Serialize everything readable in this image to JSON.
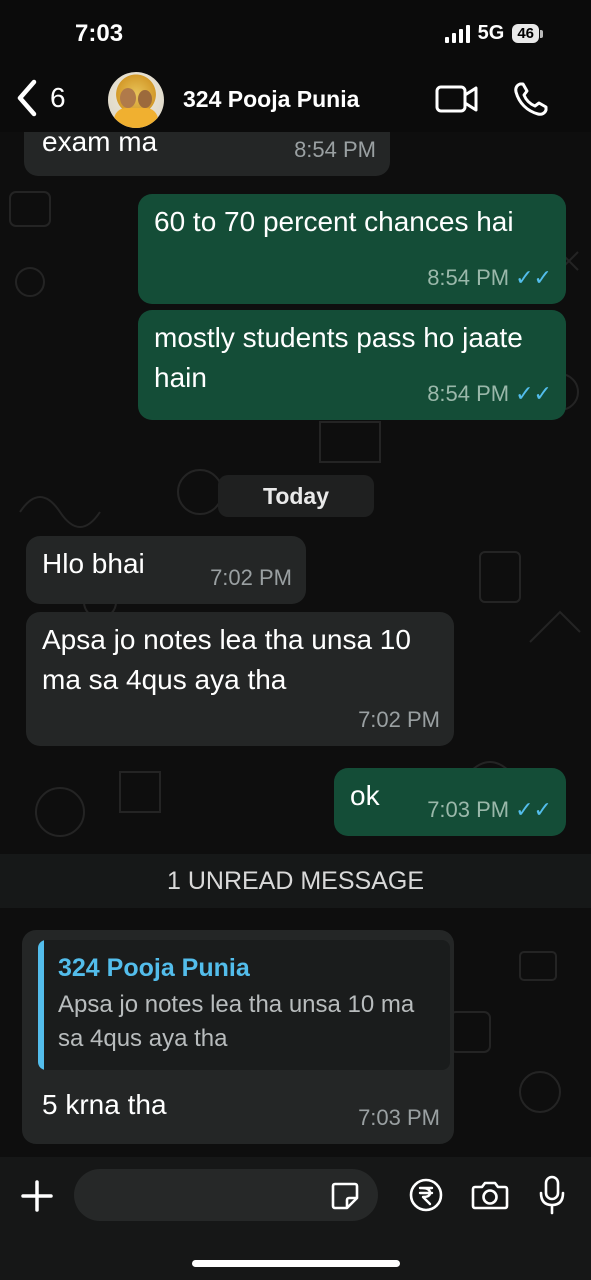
{
  "status": {
    "time": "7:03",
    "network": "5G",
    "battery": "46"
  },
  "header": {
    "back_count": "6",
    "contact_name": "324 Pooja Punia"
  },
  "messages": [
    {
      "direction": "in",
      "text": "exam ma",
      "time": "8:54 PM"
    },
    {
      "direction": "out",
      "text": "60 to 70 percent chances hai",
      "time": "8:54 PM"
    },
    {
      "direction": "out",
      "text": "mostly students pass ho jaate hain",
      "time": "8:54 PM"
    },
    {
      "direction": "in",
      "text": "Hlo bhai",
      "time": "7:02 PM"
    },
    {
      "direction": "in",
      "text": "Apsa jo notes lea tha unsa 10 ma sa 4qus aya tha",
      "time": "7:02 PM"
    },
    {
      "direction": "out",
      "text": "ok",
      "time": "7:03 PM"
    },
    {
      "direction": "in",
      "text": "5 krna tha",
      "time": "7:03 PM",
      "quote": {
        "author": "324 Pooja Punia",
        "text": "Apsa jo notes lea tha unsa 10 ma sa 4qus aya tha"
      }
    }
  ],
  "day_divider": "Today",
  "unread_divider": "1 UNREAD MESSAGE",
  "ticks": "✓✓",
  "colors": {
    "outgoing": "#144d37",
    "incoming": "#242626",
    "accent": "#53bdeb"
  },
  "icons": [
    "back-chevron-icon",
    "video-call-icon",
    "voice-call-icon",
    "plus-icon",
    "sticker-icon",
    "rupee-payment-icon",
    "camera-icon",
    "microphone-icon"
  ]
}
